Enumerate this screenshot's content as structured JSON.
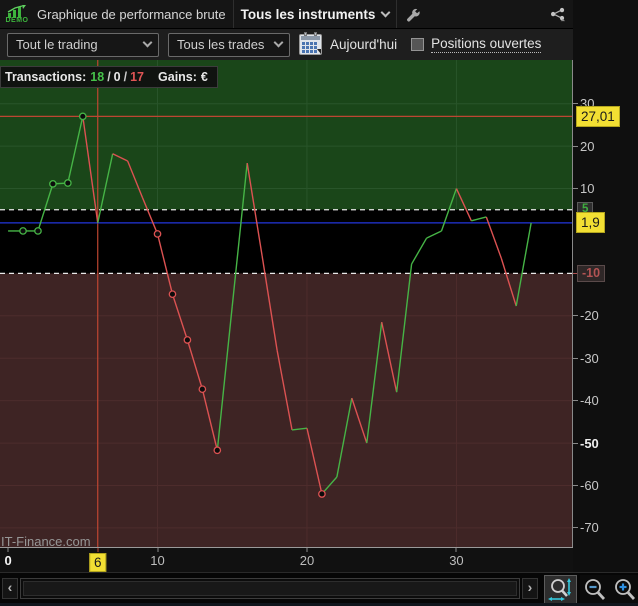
{
  "window": {
    "logo_text": "DEMO",
    "title": "Graphique de performance brute",
    "instruments_dropdown": "Tous les instruments",
    "icons": {
      "logo": "demo-chart-icon",
      "settings": "wrench-icon",
      "share": "share-icon",
      "minimize": "minimize-icon",
      "maximize": "maximize-icon",
      "close": "close-icon"
    }
  },
  "filters": {
    "trading_scope_value": "Tout le trading",
    "trade_type_value": "Tous les trades",
    "calendar_icon": "calendar-icon",
    "date_label": "Aujourd'hui",
    "open_positions_label": "Positions ouvertes",
    "open_positions_checked": false
  },
  "stats": {
    "transactions_label": "Transactions:",
    "wins": "18",
    "flat": "0",
    "losses": "17",
    "separator": "/",
    "gains_label": "Gains:",
    "currency": "€"
  },
  "watermark": "IT-Finance.com",
  "chart_data": {
    "type": "line",
    "title": "Graphique de performance brute",
    "x": [
      0,
      1,
      2,
      3,
      4,
      5,
      6,
      7,
      8,
      9,
      10,
      11,
      12,
      13,
      14,
      15,
      16,
      17,
      18,
      19,
      20,
      21,
      22,
      23,
      24,
      25,
      26,
      27,
      28,
      29,
      30,
      31,
      32,
      33,
      34,
      35
    ],
    "values": [
      0,
      0,
      0,
      11.1,
      11.3,
      27.01,
      1.9,
      18.2,
      16.5,
      7.8,
      -0.7,
      -14.9,
      -25.7,
      -37.3,
      -51.7,
      -17.7,
      16,
      -5.9,
      -28.1,
      -46.9,
      -46.5,
      -62,
      -58,
      -39.4,
      -50,
      -21.5,
      -38,
      -7.8,
      -1.7,
      0,
      10,
      2.4,
      3.3,
      -6.4,
      -17.7,
      1.9
    ],
    "marker_indices": [
      1,
      2,
      3,
      4,
      5,
      10,
      11,
      12,
      13,
      14,
      21
    ],
    "win_color": "#46b446",
    "loss_color": "#dc5252",
    "ylim": [
      -74.5,
      40.3
    ],
    "xlim": [
      -0.54,
      37.8
    ],
    "zones": {
      "upper_boundary": 5,
      "lower_boundary": -10,
      "upper_color": "#1a4619",
      "mid_color": "#000000",
      "lower_color": "#3e2424",
      "boundary_dash_color": "#e8e8e8"
    },
    "grid": {
      "h": [
        30,
        20,
        10,
        -20,
        -30,
        -40,
        -50,
        -60,
        -70
      ],
      "v": [
        10,
        20,
        30
      ],
      "pos_color": "#29552a",
      "neg_color": "#4d2c2c"
    },
    "ref_lines": {
      "max_line": {
        "value": 27.01,
        "color": "#be4632"
      },
      "current_line": {
        "value": 1.9,
        "color": "#2236dd"
      },
      "vertical_line": {
        "x": 6,
        "color": "#be4632"
      }
    },
    "y_ticks": [
      {
        "v": 30,
        "label": "30",
        "style": "plain"
      },
      {
        "v": 27.01,
        "label": "27,01",
        "style": "yellow"
      },
      {
        "v": 20,
        "label": "20",
        "style": "plain"
      },
      {
        "v": 10,
        "label": "10",
        "style": "plain"
      },
      {
        "v": 5,
        "label": "5",
        "style": "badge-green"
      },
      {
        "v": 1.9,
        "label": "1,9",
        "style": "yellow"
      },
      {
        "v": -10,
        "label": "-10",
        "style": "badge-red"
      },
      {
        "v": -20,
        "label": "-20",
        "style": "plain"
      },
      {
        "v": -30,
        "label": "-30",
        "style": "plain"
      },
      {
        "v": -40,
        "label": "-40",
        "style": "plain"
      },
      {
        "v": -50,
        "label": "-50",
        "style": "bold"
      },
      {
        "v": -60,
        "label": "-60",
        "style": "plain"
      },
      {
        "v": -70,
        "label": "-70",
        "style": "plain"
      }
    ],
    "x_ticks": [
      {
        "t": 0,
        "label": "0",
        "style": "bold"
      },
      {
        "t": 6,
        "label": "6",
        "style": "yellow"
      },
      {
        "t": 10,
        "label": "10",
        "style": "plain"
      },
      {
        "t": 20,
        "label": "20",
        "style": "plain"
      },
      {
        "t": 30,
        "label": "30",
        "style": "plain"
      }
    ]
  },
  "scrollbar": {
    "left_arrow": "‹",
    "right_arrow": "›"
  },
  "zoom_tools": {
    "fit": "zoom-fit-icon",
    "out": "zoom-out-icon",
    "in": "zoom-in-icon"
  }
}
